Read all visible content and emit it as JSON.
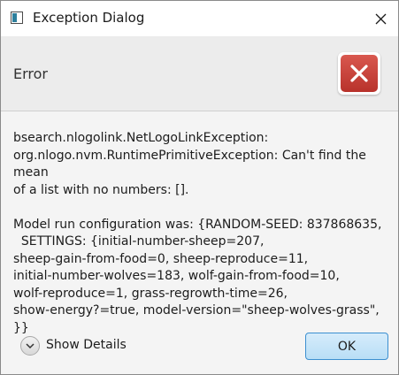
{
  "window": {
    "title": "Exception Dialog"
  },
  "header": {
    "title": "Error",
    "icon": "error-x-icon",
    "icon_color": "#c9423a"
  },
  "message": {
    "exception_lines": [
      "bsearch.nlogolink.NetLogoLinkException:",
      "org.nlogo.nvm.RuntimePrimitiveException: Can't find the mean",
      "of a list with no numbers: []."
    ],
    "config_lines": [
      "Model run configuration was: {RANDOM-SEED: 837868635,",
      "  SETTINGS: {initial-number-sheep=207,",
      "sheep-gain-from-food=0, sheep-reproduce=11,",
      "initial-number-wolves=183, wolf-gain-from-food=10,",
      "wolf-reproduce=1, grass-regrowth-time=26,",
      "show-energy?=true, model-version=\"sheep-wolves-grass\", }}"
    ]
  },
  "footer": {
    "details_label": "Show Details",
    "ok_label": "OK"
  },
  "colors": {
    "ok_button_border": "#3c8fd0",
    "ok_button_fill": "#c9e6f9"
  }
}
